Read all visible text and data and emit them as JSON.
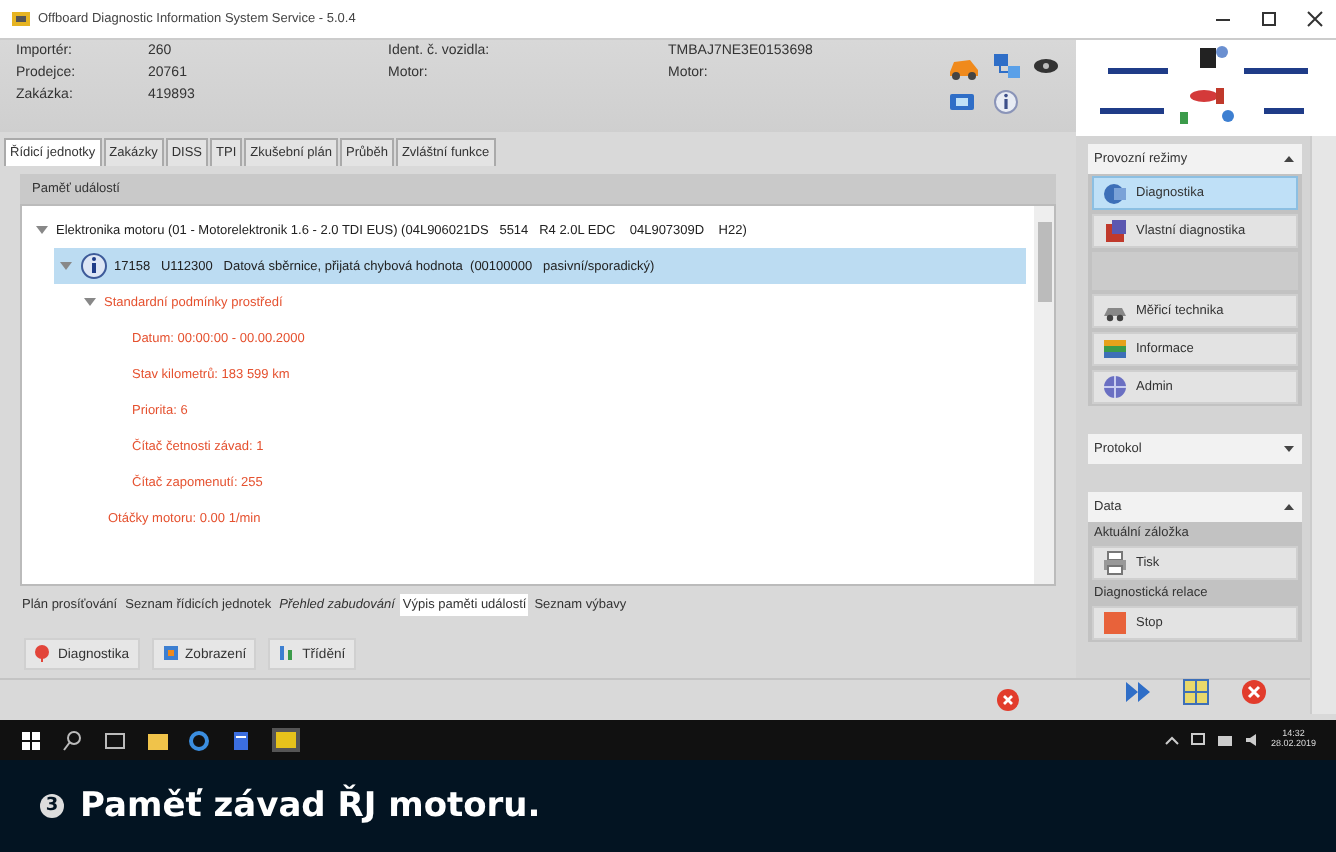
{
  "window": {
    "title": "Offboard Diagnostic Information System Service - 5.0.4"
  },
  "header": {
    "fields": [
      {
        "label": "Importér:",
        "value": "260"
      },
      {
        "label": "Prodejce:",
        "value": "20761"
      },
      {
        "label": "Zakázka:",
        "value": "419893"
      }
    ],
    "vehicle": [
      {
        "label": "Ident. č. vozidla:",
        "value": "TMBAJ7NE3E0153698"
      },
      {
        "label": "Motor:",
        "value": "Motor:"
      }
    ]
  },
  "tabs": [
    {
      "label": "Řídicí jednotky",
      "selected": true
    },
    {
      "label": "Zakázky",
      "selected": false
    },
    {
      "label": "DISS",
      "selected": false
    },
    {
      "label": "TPI",
      "selected": false
    },
    {
      "label": "Zkušební plán",
      "selected": false
    },
    {
      "label": "Průběh",
      "selected": false
    },
    {
      "label": "Zvláštní funkce",
      "selected": false
    }
  ],
  "panel": {
    "title": "Paměť událostí",
    "tree": [
      {
        "kind": "module",
        "text": "Elektronika motoru (01 - Motorelektronik 1.6 - 2.0 TDI EUS) (04L906021DS   5514   R4 2.0L EDC    04L907309D    H22)",
        "expanded": true,
        "selected": false,
        "children": [
          {
            "kind": "fault",
            "text": "17158   U112300   Datová sběrnice, přijatá chybová hodnota  (00100000   pasivní/sporadický)",
            "expanded": true,
            "selected": true,
            "children": [
              {
                "kind": "detail",
                "text": "Standardní podmínky prostředí",
                "expanded": true,
                "selected": false,
                "children": [
                  {
                    "kind": "detail",
                    "text": "Datum: 00:00:00 - 00.00.2000",
                    "selected": false
                  },
                  {
                    "kind": "detail",
                    "text": "Stav kilometrů: 183 599 km",
                    "selected": false
                  },
                  {
                    "kind": "detail",
                    "text": "Priorita: 6",
                    "selected": false
                  },
                  {
                    "kind": "detail",
                    "text": "Čítač četnosti závad: 1",
                    "selected": false
                  },
                  {
                    "kind": "detail",
                    "text": "Čítač zapomenutí: 255",
                    "selected": false
                  }
                ]
              },
              {
                "kind": "detail",
                "text": "Otáčky motoru: 0.00 1/min",
                "selected": false
              }
            ]
          }
        ]
      }
    ]
  },
  "view_tabs": [
    {
      "label": "Plán prosíťování",
      "selected": false,
      "italic": false
    },
    {
      "label": "Seznam řídicích jednotek",
      "selected": false,
      "italic": false
    },
    {
      "label": "Přehled zabudování",
      "selected": false,
      "italic": true
    },
    {
      "label": "Výpis paměti událostí",
      "selected": true,
      "italic": false
    },
    {
      "label": "Seznam výbavy",
      "selected": false,
      "italic": false
    }
  ],
  "toolbar": [
    {
      "label": "Diagnostika"
    },
    {
      "label": "Zobrazení"
    },
    {
      "label": "Třídění"
    }
  ],
  "sidebar": {
    "sections": [
      {
        "title": "Provozní režimy",
        "expanded": true,
        "items": [
          {
            "kind": "button",
            "label": "Diagnostika",
            "selected": true
          },
          {
            "kind": "button",
            "label": "Vlastní diagnostika",
            "selected": false
          },
          {
            "kind": "empty"
          },
          {
            "kind": "button",
            "label": "Měřicí technika",
            "selected": false
          },
          {
            "kind": "button",
            "label": "Informace",
            "selected": false
          },
          {
            "kind": "button",
            "label": "Admin",
            "selected": false
          }
        ]
      },
      {
        "title": "Protokol",
        "expanded": false
      },
      {
        "title": "Data",
        "expanded": true,
        "items": [
          {
            "kind": "heading",
            "label": "Aktuální záložka"
          },
          {
            "kind": "button",
            "label": "Tisk",
            "selected": false
          },
          {
            "kind": "heading",
            "label": "Diagnostická relace"
          },
          {
            "kind": "button",
            "label": "Stop",
            "selected": false
          }
        ]
      }
    ]
  },
  "taskbar": {
    "time": "14:32",
    "date": "28.02.2019"
  },
  "caption": {
    "number": "3",
    "text": "Paměť závad ŘJ motoru."
  }
}
